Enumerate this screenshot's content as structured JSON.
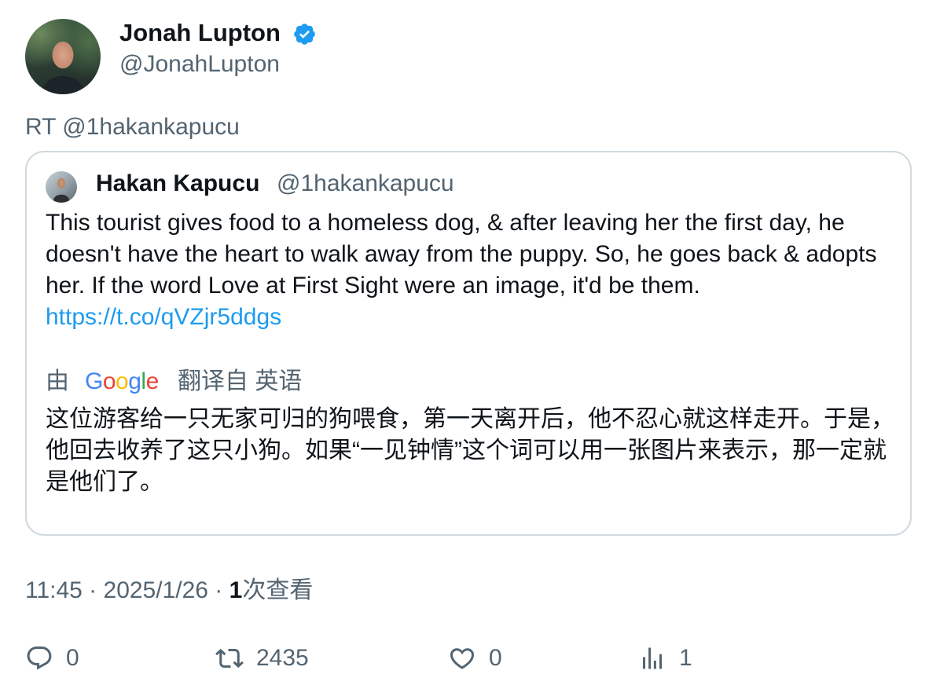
{
  "author": {
    "name": "Jonah Lupton",
    "handle": "@JonahLupton",
    "verified": true
  },
  "retweet_line": "RT @1hakankapucu",
  "quoted_tweet": {
    "name": "Hakan Kapucu",
    "handle": "@1hakankapucu",
    "text": "This tourist gives food to a homeless dog, & after leaving her the first day, he doesn't have the heart to walk away from the puppy. So, he goes back & adopts her. If the word Love at First Sight were an image, it'd be them.",
    "link": "https://t.co/qVZjr5ddgs",
    "translation": {
      "by_label": "由",
      "provider": "Google",
      "from_label": "翻译自 英语",
      "text": "这位游客给一只无家可归的狗喂食，第一天离开后，他不忍心就这样走开。于是，他回去收养了这只小狗。如果“一见钟情”这个词可以用一张图片来表示，那一定就是他们了。"
    }
  },
  "meta": {
    "time_date": "11:45 · 2025/1/26 · ",
    "views_count": "1",
    "views_label": "次查看"
  },
  "actions": {
    "reply": {
      "icon": "reply-icon",
      "count": "0"
    },
    "retweet": {
      "icon": "retweet-icon",
      "count": "2435"
    },
    "like": {
      "icon": "heart-icon",
      "count": "0"
    },
    "views": {
      "icon": "analytics-icon",
      "count": "1"
    }
  },
  "colors": {
    "link": "#1d9bf0",
    "secondary_text": "#536471",
    "verified_badge": "#1d9bf0",
    "border": "#cfd9de"
  }
}
